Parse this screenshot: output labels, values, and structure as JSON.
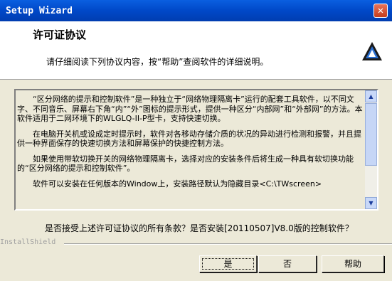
{
  "window": {
    "title": "Setup Wizard",
    "close_glyph": "✕"
  },
  "header": {
    "title": "许可证协议",
    "subtitle": "请仔细阅读下列协议内容，按“帮助”查阅软件的详细说明。",
    "logo_icon": "installshield-logo"
  },
  "license": {
    "paragraphs": [
      "“区分网络的提示和控制软件”是一种独立于“网络物理隔离卡”运行的配套工具软件，以不同文字、不同音乐、屏幕右下角“内”“外”图标的提示形式，提供一种区分“内部网”和“外部网”的方法。本软件适用于二网环境下的WLGLQ-II-P型卡，支持快速切换。",
      "在电脑开关机或设成定时提示时，软件对各移动存储介质的状况的异动进行检测和报警，并且提供一种界面保存的快速切换方法和屏幕保护的快捷控制方法。",
      "如果使用带软切换开关的网络物理隔离卡，选择对应的安装条件后将生成一种具有软切换功能的“区分网络的提示和控制软件”。",
      "软件可以安装在任何版本的Window上，安装路径默认为隐藏目录<C:\\TWscreen>"
    ]
  },
  "question": "是否接受上述许可证协议的所有条款？是否安装[20110507]V8.0版的控制软件？",
  "footer": {
    "brand": "InstallShield",
    "buttons": {
      "yes": "是",
      "no": "否",
      "help": "帮助"
    }
  },
  "colors": {
    "titlebar": "#0048c8",
    "dialog_bg": "#ece9d8",
    "close": "#c43c1c"
  }
}
